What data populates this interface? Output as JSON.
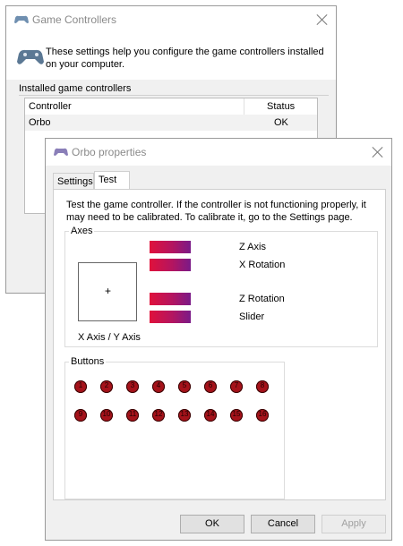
{
  "game_controllers": {
    "title": "Game Controllers",
    "description": "These settings help you configure the game controllers installed on your computer.",
    "group_label": "Installed game controllers",
    "columns": [
      "Controller",
      "Status"
    ],
    "rows": [
      {
        "controller": "Orbo",
        "status": "OK"
      }
    ]
  },
  "properties": {
    "title": "Orbo properties",
    "tabs": [
      {
        "label": "Settings",
        "selected": false
      },
      {
        "label": "Test",
        "selected": true
      }
    ],
    "test_description": "Test the game controller.  If the controller is not functioning properly, it may need to be calibrated.  To calibrate it, go to the Settings page.",
    "axes": {
      "label": "Axes",
      "xy_label": "X Axis / Y Axis",
      "bars": [
        {
          "label": "Z Axis"
        },
        {
          "label": "X Rotation"
        },
        {
          "label": "Z Rotation"
        },
        {
          "label": "Slider"
        }
      ]
    },
    "buttons": {
      "label": "Buttons",
      "numbers": [
        "1",
        "2",
        "3",
        "4",
        "5",
        "6",
        "7",
        "8",
        "9",
        "10",
        "11",
        "12",
        "13",
        "14",
        "15",
        "16"
      ]
    },
    "ok_label": "OK",
    "cancel_label": "Cancel",
    "apply_label": "Apply"
  },
  "colors": {
    "button_indicator": "#a5121a",
    "axis_bar_start": "#e0113b",
    "axis_bar_end": "#7a1a88"
  }
}
